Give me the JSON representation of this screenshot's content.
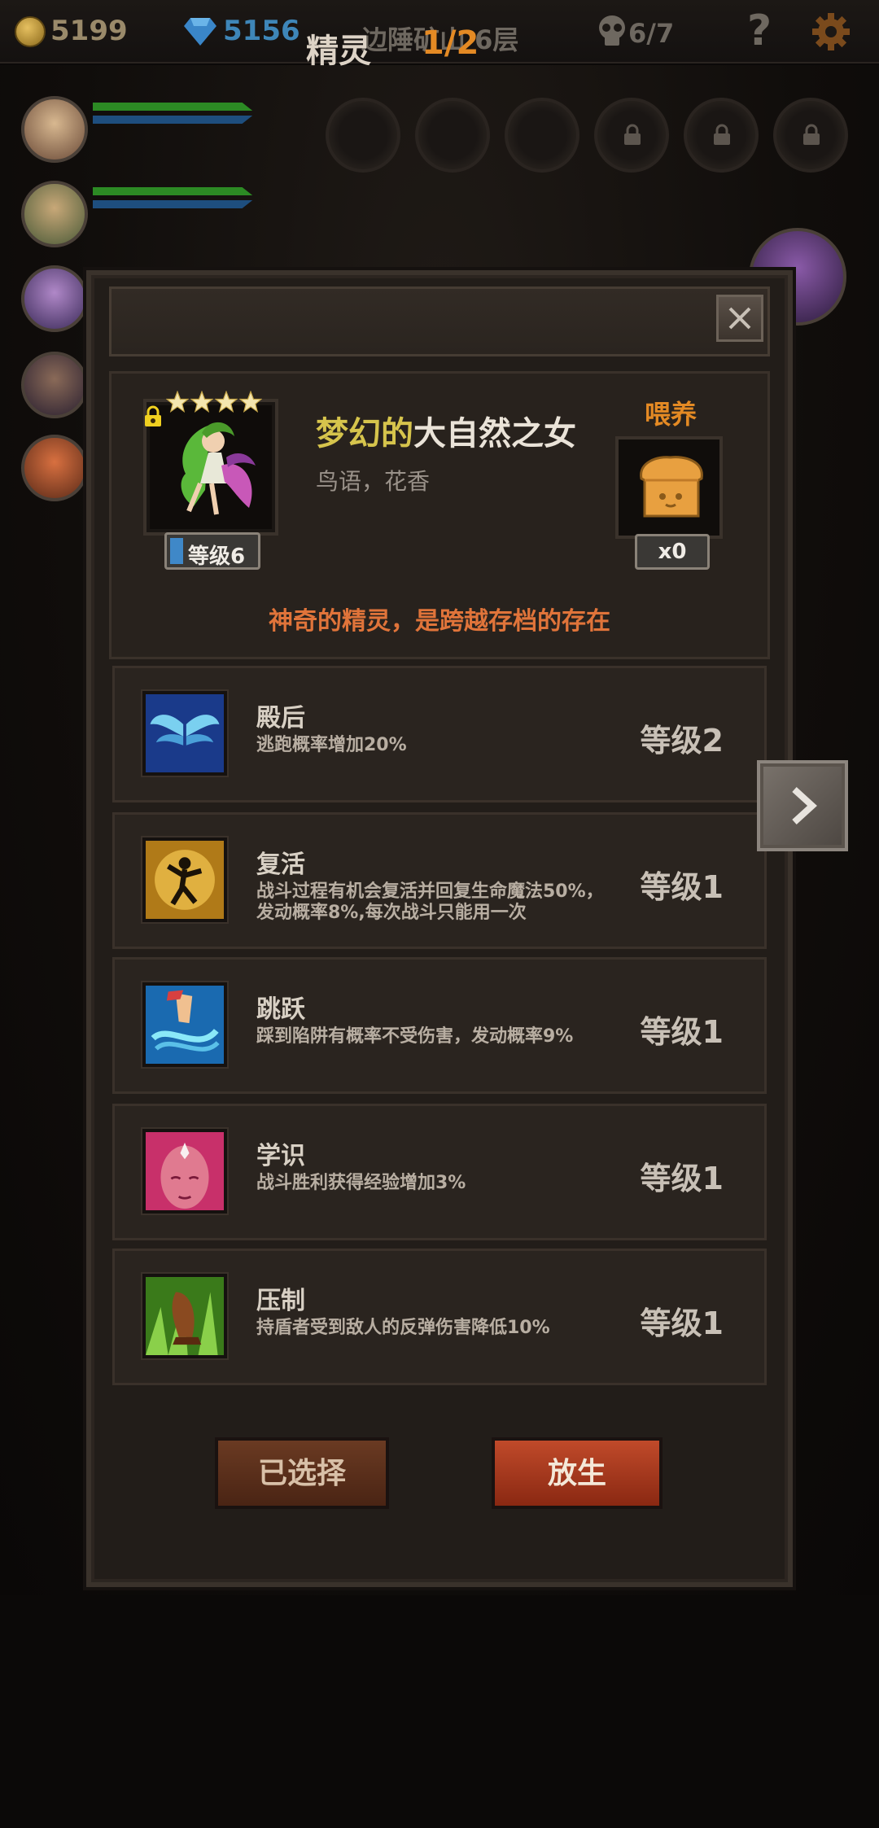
{
  "topbar": {
    "gold": "5199",
    "gems": "5156",
    "floor": "边陲矿山 6层",
    "kills": "6/7",
    "help": "?",
    "colors": {
      "gold": "#9a8a6a",
      "gems": "#3e86b8"
    }
  },
  "dialog": {
    "title": "精灵",
    "page": "1/2",
    "fairy": {
      "stars": 4,
      "locked": true,
      "level_label": "等级6",
      "name_prefix": "梦幻的",
      "name_base": "大自然之女",
      "traits": "鸟语，花香",
      "description": "神奇的精灵，是跨越存档的存在"
    },
    "feed": {
      "label": "喂养",
      "item_icon": "bread-icon",
      "count": "x0"
    },
    "skills": [
      {
        "name": "殿后",
        "desc": "逃跑概率增加20%",
        "level": "等级2",
        "icon": "wings-icon"
      },
      {
        "name": "复活",
        "desc": "战斗过程有机会复活并回复生命魔法50%，发动概率8%,每次战斗只能用一次",
        "level": "等级1",
        "icon": "revive-icon"
      },
      {
        "name": "跳跃",
        "desc": "踩到陷阱有概率不受伤害，发动概率9%",
        "level": "等级1",
        "icon": "jump-icon"
      },
      {
        "name": "学识",
        "desc": "战斗胜利获得经验增加3%",
        "level": "等级1",
        "icon": "knowledge-icon"
      },
      {
        "name": "压制",
        "desc": "持盾者受到敌人的反弹伤害降低10%",
        "level": "等级1",
        "icon": "suppress-icon"
      }
    ],
    "buttons": {
      "selected": "已选择",
      "release": "放生"
    },
    "colors": {
      "accent": "#e48a24",
      "description": "#e0743a",
      "name_prefix": "#d6c44c"
    }
  }
}
